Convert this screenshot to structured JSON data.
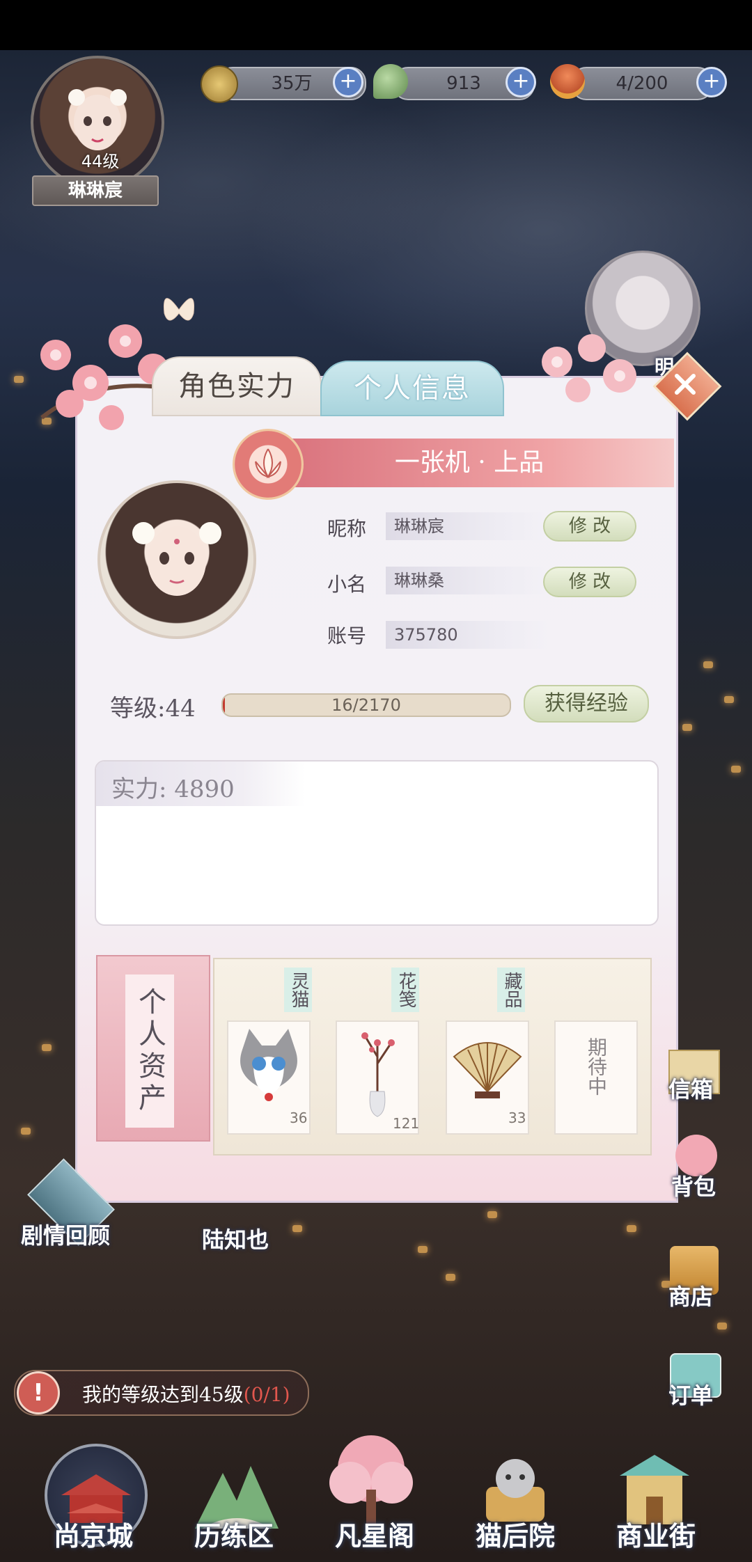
{
  "player": {
    "level_text": "44级",
    "name": "琳琳宸"
  },
  "resources": [
    {
      "icon": "paw-coin-icon",
      "value": "35万"
    },
    {
      "icon": "jade-bird-icon",
      "value": "913"
    },
    {
      "icon": "food-basket-icon",
      "value": "4/200"
    }
  ],
  "tabs": {
    "strength": "角色实力",
    "personal_info": "个人信息"
  },
  "rank_banner": "一张机 · 上品",
  "profile": {
    "nickname_label": "昵称",
    "nickname_value": "琳琳宸",
    "alias_label": "小名",
    "alias_value": "琳琳桑",
    "account_label": "账号",
    "account_value": "375780",
    "edit_label": "修 改"
  },
  "level": {
    "label": "等级:",
    "value": "44",
    "exp_text": "16/2170",
    "exp_progress": 0.0074,
    "gain_exp_button": "获得经验"
  },
  "power": {
    "label": "实力:",
    "value": "4890"
  },
  "assets": {
    "title": "个人资产",
    "items": [
      {
        "tag": "灵猫",
        "icon": "cat-icon",
        "count": "36"
      },
      {
        "tag": "花笺",
        "icon": "flower-vase-icon",
        "count": "121"
      },
      {
        "tag": "藏品",
        "icon": "folding-fan-icon",
        "count": "33"
      }
    ],
    "placeholder": "期待中"
  },
  "side_menu": {
    "story_review": "剧情回顾",
    "npc_name": "陆知也",
    "mailbox": "信箱",
    "backpack": "背包",
    "shop": "商店",
    "orders": "订单",
    "peek_text": "明"
  },
  "quest": {
    "text": "我的等级达到45级",
    "progress": "(0/1)"
  },
  "bottom_nav": [
    "尚京城",
    "历练区",
    "凡星阁",
    "猫后院",
    "商业街"
  ],
  "colors": {
    "accent_pink": "#d86f7a",
    "tab_teal": "#bfe1e8",
    "button_green": "#d3ddbc",
    "progress_red": "#c23b2f"
  }
}
